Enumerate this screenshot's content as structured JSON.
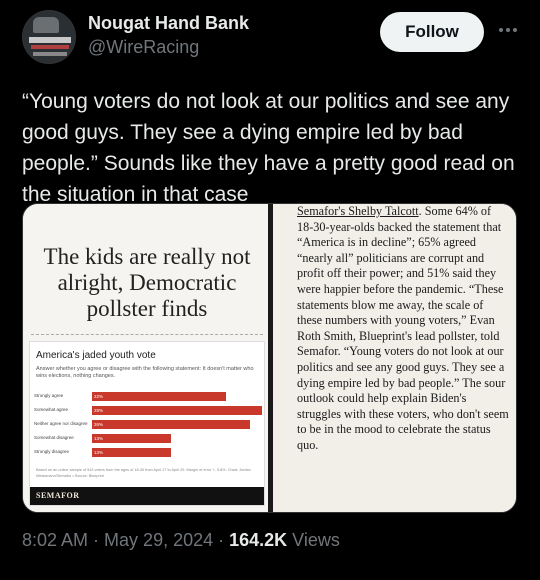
{
  "author": {
    "display_name": "Nougat Hand Bank",
    "handle": "@WireRacing"
  },
  "follow_label": "Follow",
  "tweet_text": "“Young voters do not look at our politics and see any good guys. They see a dying empire led by bad people.” Sounds like they have a pretty good read on the situation in that case",
  "image_left": {
    "headline": "The kids are really not alright, Democratic pollster finds",
    "chart_title": "America's jaded youth vote",
    "chart_subtitle": "Answer whether you agree or disagree with the following statement: It doesn't matter who wins elections, nothing changes.",
    "chart_footnote": "Based on an online sample of 943 voters from the ages of 18-30 from April 27 to April 29. Margin of error +- 5.8%. Chart: Jordan Weissmann/Semafor • Source: Blueprint",
    "brand": "SEMAFOR",
    "bar_color": "#c8382b"
  },
  "chart_data": {
    "type": "bar",
    "title": "America's jaded youth vote",
    "categories": [
      "Strongly agree",
      "Somewhat agree",
      "Neither agree nor disagree",
      "Somewhat disagree",
      "Strongly disagree"
    ],
    "values": [
      22,
      28,
      26,
      13,
      13
    ],
    "value_labels": [
      "22%",
      "28%",
      "26%",
      "13%",
      "13%"
    ],
    "xlim": [
      0,
      28
    ]
  },
  "image_right": {
    "link_text": "Semafor's Shelby Talcott",
    "body_text": ". Some 64% of 18-30-year-olds backed the statement that “America is in decline”; 65% agreed “nearly all” politicians are corrupt and profit off their power; and 51% said they were happier before the pandemic. “These statements blow me away, the scale of these numbers with young voters,” Evan Roth Smith, Blueprint's lead pollster, told Semafor. “Young voters do not look at our politics and see any good guys. They see a dying empire led by bad people.” The sour outlook could help explain Biden's struggles with these voters, who don't seem to be in the mood to celebrate the status quo."
  },
  "meta": {
    "time": "8:02 AM",
    "sep": " · ",
    "date": "May 29, 2024",
    "views_count": "164.2K",
    "views_label": " Views"
  }
}
